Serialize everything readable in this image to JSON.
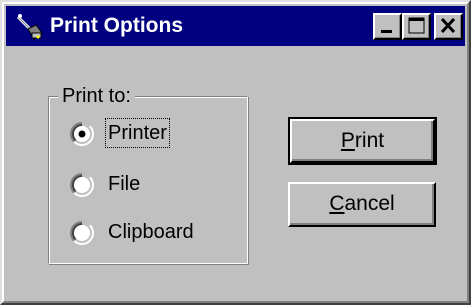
{
  "window": {
    "title": "Print Options",
    "icon": "printer-wand-icon",
    "caption_buttons": [
      "minimize",
      "maximize",
      "close"
    ]
  },
  "group": {
    "label": "Print to:",
    "options": [
      {
        "label": "Printer",
        "selected": true,
        "focused": true
      },
      {
        "label": "File",
        "selected": false,
        "focused": false
      },
      {
        "label": "Clipboard",
        "selected": false,
        "focused": false
      }
    ]
  },
  "buttons": {
    "print": {
      "label_mnemonic": "P",
      "label_rest": "rint",
      "default": true
    },
    "cancel": {
      "label_mnemonic": "C",
      "label_rest": "ancel",
      "default": false
    }
  },
  "colors": {
    "titlebar": "#000080",
    "face": "#c0c0c0",
    "title_text": "#ffffff"
  }
}
